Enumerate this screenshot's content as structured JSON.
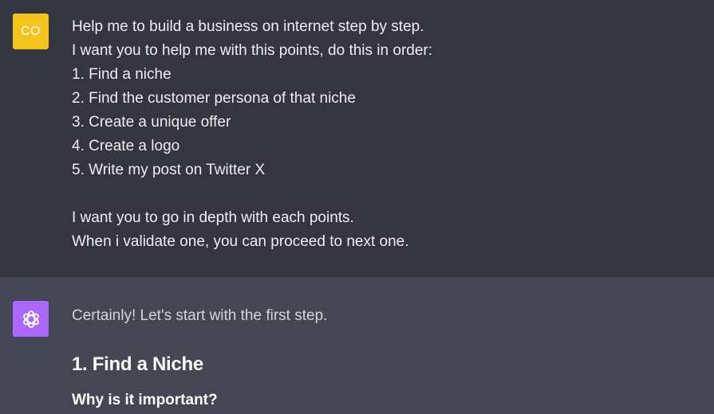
{
  "user_message": {
    "avatar_initials": "CO",
    "avatar_color": "#f4c41c",
    "lines": [
      "Help me to build a business on internet step by step.",
      "I want you to help me with this points, do this in order:",
      "1. Find a niche",
      "2. Find the customer persona of that niche",
      "3. Create a unique offer",
      "4. Create a logo",
      "5. Write my post on Twitter X",
      "",
      "I want you to go in depth with each points.",
      "When i validate one, you can proceed to next one."
    ]
  },
  "assistant_message": {
    "avatar_icon": "openai-logo-icon",
    "avatar_color": "#ab68ff",
    "intro": "Certainly! Let's start with the first step.",
    "heading": "1. Find a Niche",
    "subheading": "Why is it important?"
  }
}
